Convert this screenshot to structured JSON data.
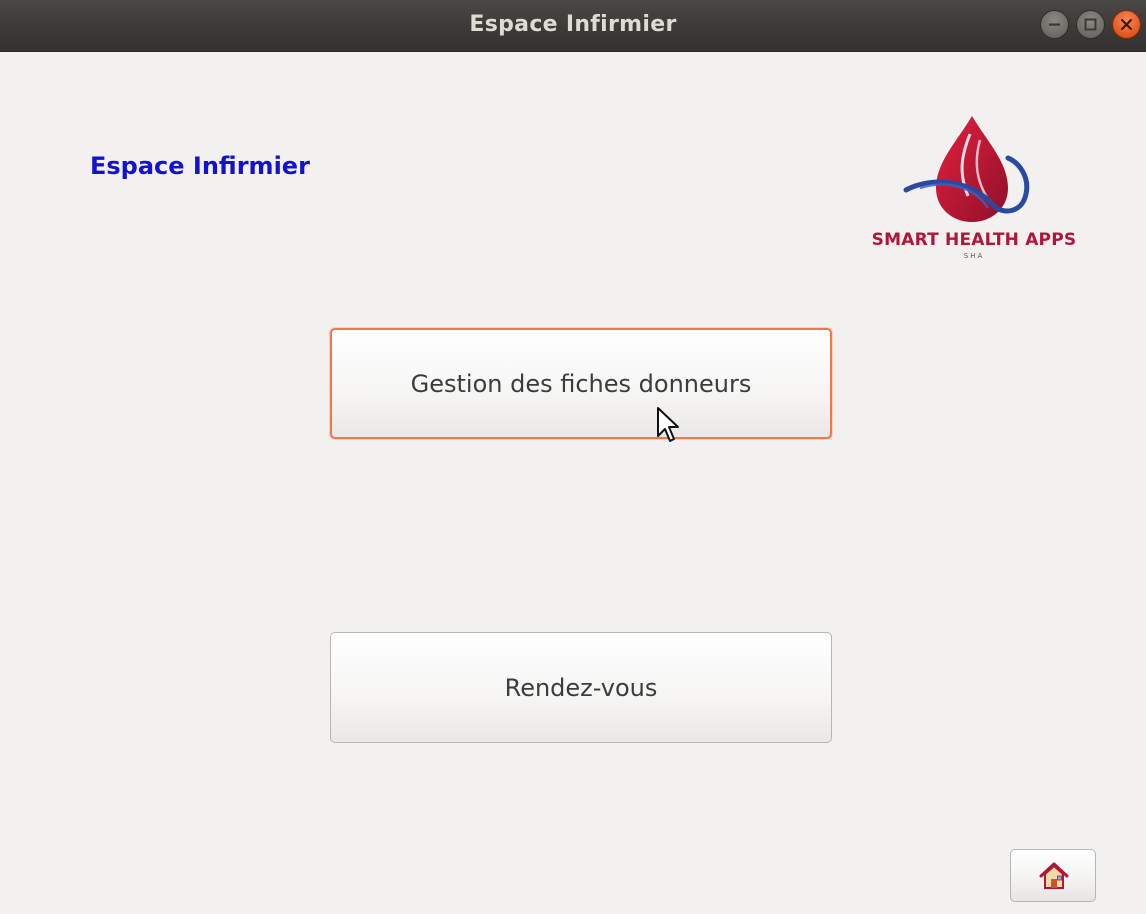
{
  "window": {
    "title": "Espace Infirmier"
  },
  "page": {
    "heading": "Espace Infirmier",
    "heading_color": "#1212d0"
  },
  "logo": {
    "name": "SMART HEALTH APPS",
    "abbr": "SHA",
    "brand_red": "#b0163a",
    "brand_blue": "#2a4aa0"
  },
  "buttons": {
    "fiches_label": "Gestion des fiches donneurs",
    "rdv_label": "Rendez-vous",
    "home_icon": "home-icon"
  },
  "colors": {
    "focus_ring": "#f07746",
    "close_button": "#e2551c"
  }
}
